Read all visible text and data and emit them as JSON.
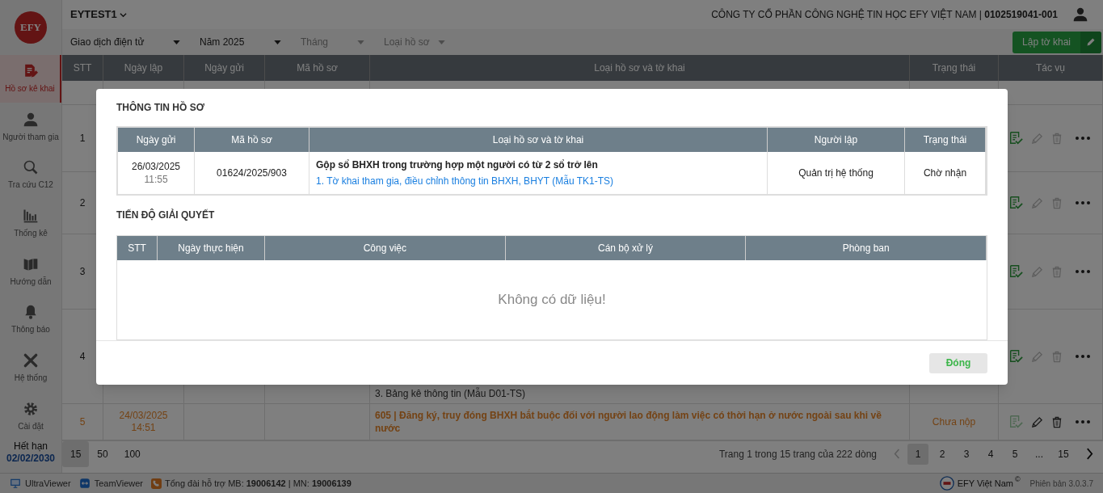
{
  "sidebar": {
    "logo": "EFY",
    "items": [
      {
        "label": "Hồ sơ kê khai",
        "selected": true,
        "kind": "file"
      },
      {
        "label": "Người tham gia",
        "selected": false,
        "kind": "user"
      },
      {
        "label": "Tra cứu C12",
        "selected": false,
        "kind": "search"
      },
      {
        "label": "Thống kê",
        "selected": false,
        "kind": "chart"
      },
      {
        "label": "Hướng dẫn",
        "selected": false,
        "kind": "book"
      },
      {
        "label": "Thông báo",
        "selected": false,
        "kind": "bell"
      },
      {
        "label": "Hệ thống",
        "selected": false,
        "kind": "tools"
      },
      {
        "label": "Cài đặt",
        "selected": false,
        "kind": "gear"
      }
    ],
    "expiry": {
      "label": "Hết hạn",
      "date": "02/02/2030"
    }
  },
  "header": {
    "account": "EYTEST1",
    "company": "CÔNG TY CỔ PHẦN CÔNG NGHỆ TIN HỌC EFY VIỆT NAM | **0102519041-001**"
  },
  "filters": [
    {
      "value": "Giao dịch điện tử"
    },
    {
      "value": "Năm 2025"
    },
    {
      "placeholder": "Tháng"
    },
    {
      "placeholder": "Loại hồ sơ"
    }
  ],
  "create_button": "Lập tờ khai",
  "table": {
    "columns": [
      "STT",
      "Ngày lập",
      "Ngày gửi",
      "Mã hồ sơ",
      "Loại hồ sơ và tờ khai",
      "Trạng thái",
      "Tác vụ"
    ],
    "rows": [
      {
        "stt": "1",
        "submitted": true
      },
      {
        "stt": "2",
        "submitted": true
      },
      {
        "stt": "3",
        "submitted": true
      },
      {
        "stt": "4",
        "submitted": true,
        "lines": [
          "3. Bảng kê thông tin (Mẫu D01-TS)"
        ]
      },
      {
        "stt": "5",
        "submitted": false,
        "created": "24/03/2025",
        "time": "14:51",
        "title": "605 | Đăng ký, truy đóng BHXH bắt buộc đối với người lao động làm việc có thời hạn ở nước ngoài sau khi về nước",
        "status": "Chưa nộp"
      }
    ]
  },
  "pagination": {
    "page_sizes": [
      {
        "label": "15",
        "selected": true
      },
      {
        "label": "50",
        "selected": false
      },
      {
        "label": "100",
        "selected": false
      }
    ],
    "summary": "Trang 1 trong 15 trang của 222 dòng",
    "pages": [
      {
        "label": "1",
        "selected": true
      },
      {
        "label": "2",
        "selected": false
      },
      {
        "label": "3",
        "selected": false
      },
      {
        "label": "4",
        "selected": false
      },
      {
        "label": "5",
        "selected": false
      },
      {
        "label": "...",
        "selected": false
      },
      {
        "label": "15",
        "selected": false
      }
    ]
  },
  "footer": {
    "tools": [
      {
        "label": "UltraViewer",
        "kind": "monitor"
      },
      {
        "label": "TeamViewer",
        "kind": "teamviewer"
      }
    ],
    "hotline": "Tổng đài hỗ trợ MB: **19006142** | MN: **19006139**",
    "brand": "EFY Việt Nam",
    "brand_mark": "©",
    "version": "Phiên bản 3.0.3.7"
  },
  "modal": {
    "section_title": "THÔNG TIN HỒ SƠ",
    "info_table": {
      "columns": [
        "Ngày gửi",
        "Mã hồ sơ",
        "Loại hồ sơ và tờ khai",
        "Người lập",
        "Trạng thái"
      ],
      "rows": [
        {
          "sent_date": "26/03/2025",
          "sent_time": "11:55",
          "code": "01624/2025/903",
          "title": "Gộp sổ BHXH trong trường hợp một người có từ 2 sổ trở lên",
          "forms": [
            "1. Tờ khai tham gia, điều chỉnh thông tin BHXH, BHYT (Mẫu TK1-TS)"
          ],
          "creator": "Quản trị hệ thống",
          "status": "Chờ nhận"
        }
      ]
    },
    "progress_title": "TIẾN ĐỘ GIẢI QUYẾT",
    "progress_table": {
      "columns": [
        "STT",
        "Ngày thực hiện",
        "Công việc",
        "Cán bộ xử lý",
        "Phòng ban"
      ],
      "empty_text": "Không có dữ liệu!"
    },
    "close_button": "Đóng"
  }
}
